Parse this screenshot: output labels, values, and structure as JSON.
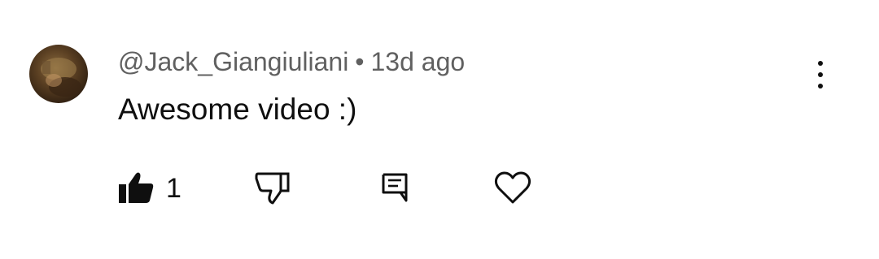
{
  "comment": {
    "author": "@Jack_Giangiuliani",
    "separator": "•",
    "time": "13d ago",
    "text": "Awesome video :)",
    "like_count": "1"
  },
  "icons": {
    "menu": "more-vertical-icon",
    "like": "thumbs-up-filled-icon",
    "dislike": "thumbs-down-outline-icon",
    "reply": "comment-reply-icon",
    "heart": "heart-outline-icon"
  },
  "colors": {
    "meta_text": "#606060",
    "body_text": "#0f0f0f",
    "background": "#ffffff"
  }
}
